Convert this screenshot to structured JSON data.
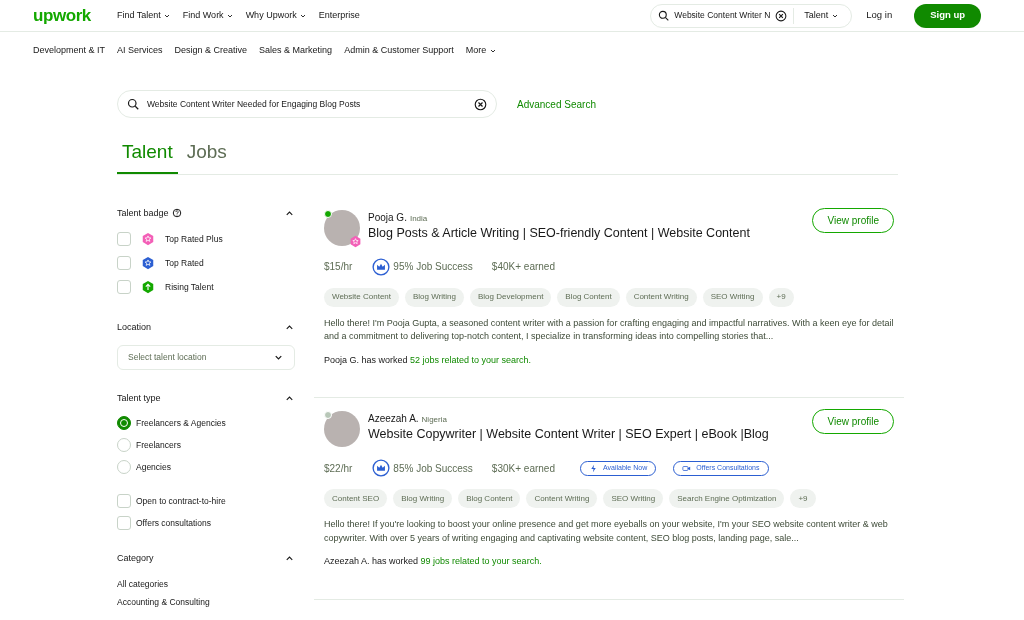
{
  "header": {
    "logo": "upwork",
    "nav": [
      {
        "label": "Find Talent",
        "dropdown": true
      },
      {
        "label": "Find Work",
        "dropdown": true
      },
      {
        "label": "Why Upwork",
        "dropdown": true
      },
      {
        "label": "Enterprise",
        "dropdown": false
      }
    ],
    "search": {
      "value": "Website Content Writer N",
      "scope": "Talent"
    },
    "login": "Log in",
    "signup": "Sign up"
  },
  "categories": [
    {
      "label": "Development & IT",
      "dropdown": false
    },
    {
      "label": "AI Services",
      "dropdown": false
    },
    {
      "label": "Design & Creative",
      "dropdown": false
    },
    {
      "label": "Sales & Marketing",
      "dropdown": false
    },
    {
      "label": "Admin & Customer Support",
      "dropdown": false
    },
    {
      "label": "More",
      "dropdown": true
    }
  ],
  "search": {
    "value": "Website Content Writer Needed for Engaging Blog Posts",
    "advanced": "Advanced Search"
  },
  "tabs": [
    {
      "label": "Talent",
      "selected": true
    },
    {
      "label": "Jobs",
      "selected": false
    }
  ],
  "filters": {
    "talent_badge": {
      "title": "Talent badge",
      "options": [
        {
          "label": "Top Rated Plus",
          "kind": "plus",
          "checked": false
        },
        {
          "label": "Top Rated",
          "kind": "rated",
          "checked": false
        },
        {
          "label": "Rising Talent",
          "kind": "rising",
          "checked": false
        }
      ]
    },
    "location": {
      "title": "Location",
      "placeholder": "Select talent location"
    },
    "talent_type": {
      "title": "Talent type",
      "options": [
        {
          "label": "Freelancers & Agencies",
          "selected": true
        },
        {
          "label": "Freelancers",
          "selected": false
        },
        {
          "label": "Agencies",
          "selected": false
        }
      ],
      "checks": [
        {
          "label": "Open to contract-to-hire",
          "checked": false
        },
        {
          "label": "Offers consultations",
          "checked": false
        }
      ]
    },
    "category": {
      "title": "Category",
      "items": [
        "All categories",
        "Accounting & Consulting"
      ]
    }
  },
  "results": [
    {
      "name": "Pooja G.",
      "country": "India",
      "online": true,
      "top_rated_plus": true,
      "title": "Blog Posts & Article Writing | SEO-friendly Content | Website Content",
      "rate": "$15/hr",
      "job_success": "95% Job Success",
      "earned": "$40K+ earned",
      "skills": [
        "Website Content",
        "Blog Writing",
        "Blog Development",
        "Blog Content",
        "Content Writing",
        "SEO Writing",
        "+9"
      ],
      "description": "Hello there! I'm Pooja Gupta, a seasoned content writer with a passion for crafting engaging and impactful narratives. With a keen eye for detail and a commitment to delivering top-notch content, I specialize in transforming ideas into compelling stories that...",
      "worked_prefix": "Pooja G. has worked",
      "worked_link": "52 jobs related to your search.",
      "action": "View profile"
    },
    {
      "name": "Azeezah A.",
      "country": "Nigeria",
      "online": false,
      "top_rated_plus": false,
      "title": "Website Copywriter | Website Content Writer | SEO Expert | eBook |Blog",
      "rate": "$22/hr",
      "job_success": "85% Job Success",
      "earned": "$30K+ earned",
      "pills": [
        {
          "label": "Available Now",
          "kind": "bolt"
        },
        {
          "label": "Offers Consultations",
          "kind": "video"
        }
      ],
      "skills": [
        "Content SEO",
        "Blog Writing",
        "Blog Content",
        "Content Writing",
        "SEO Writing",
        "Search Engine Optimization",
        "+9"
      ],
      "description": "Hello there! If you're looking to boost your online presence and get more eyeballs on your website, I'm your SEO website content writer & web copywriter. With over 5 years of writing engaging and captivating website content, SEO blog posts, landing page, sale...",
      "worked_prefix": "Azeezah A. has worked",
      "worked_link": "99 jobs related to your search.",
      "action": "View profile"
    }
  ]
}
